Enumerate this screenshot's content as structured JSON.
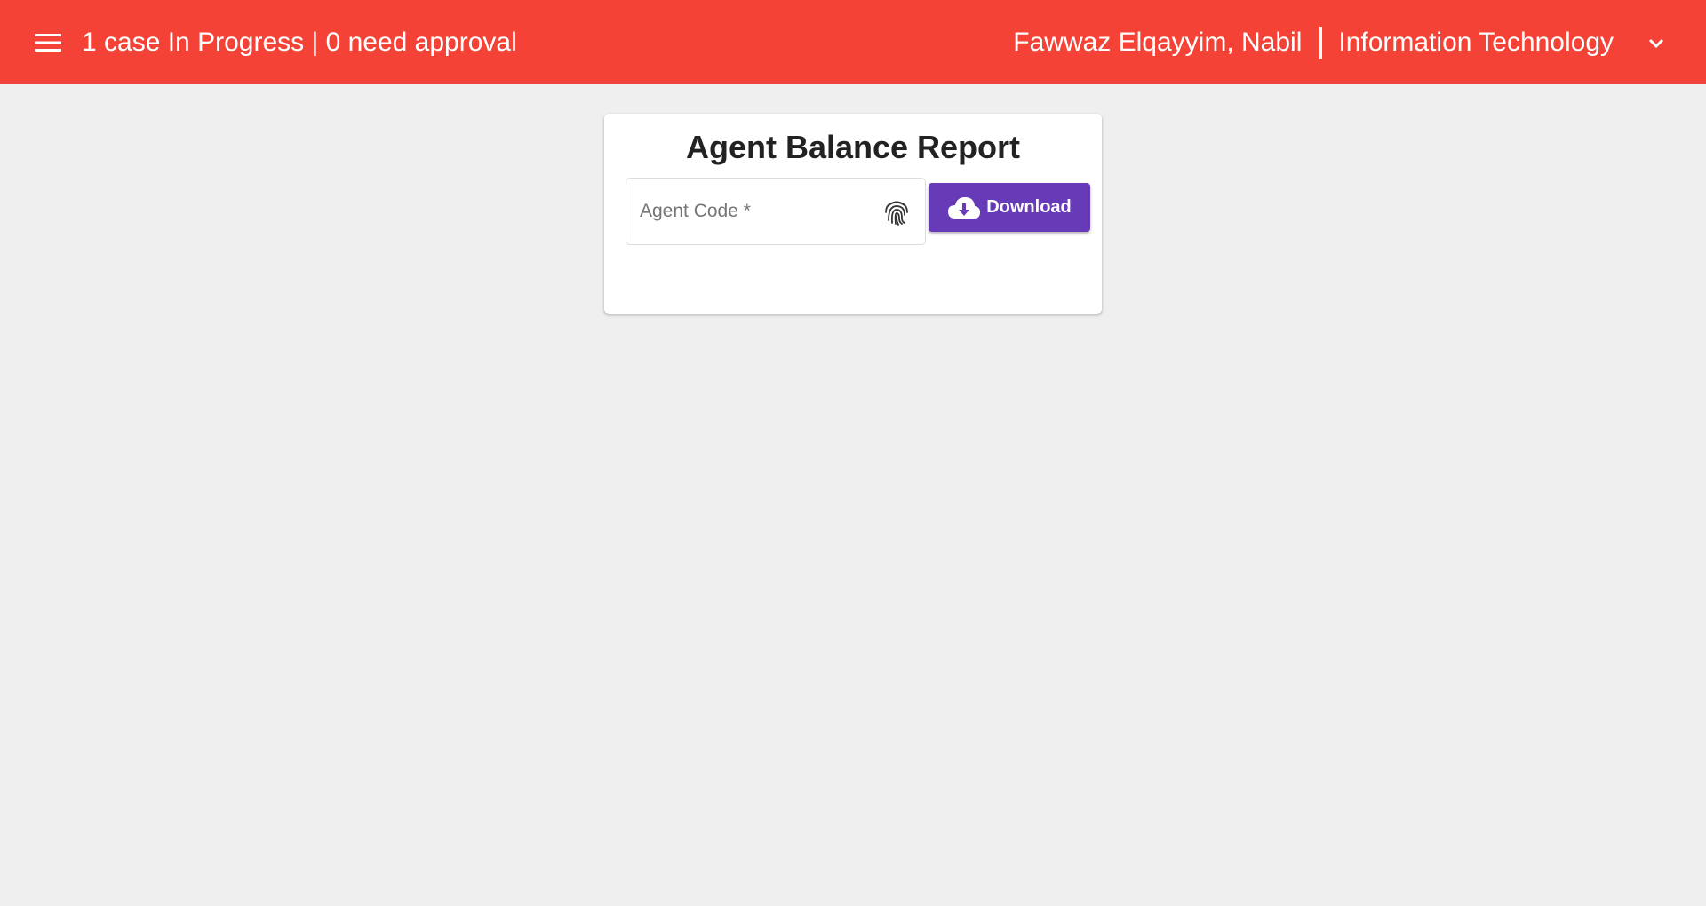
{
  "header": {
    "status": "1 case In Progress | 0 need approval",
    "user_name": "Fawwaz Elqayyim, Nabil",
    "department": "Information Technology",
    "menu_icon": "menu-icon",
    "dropdown_icon": "chevron-down-icon",
    "background_color": "#f44336"
  },
  "report": {
    "title": "Agent Balance Report",
    "agent_code": {
      "placeholder": "Agent Code *",
      "value": "",
      "icon": "fingerprint-icon"
    },
    "download": {
      "label": "Download",
      "icon": "cloud-download-icon",
      "color": "#673ab7"
    }
  }
}
